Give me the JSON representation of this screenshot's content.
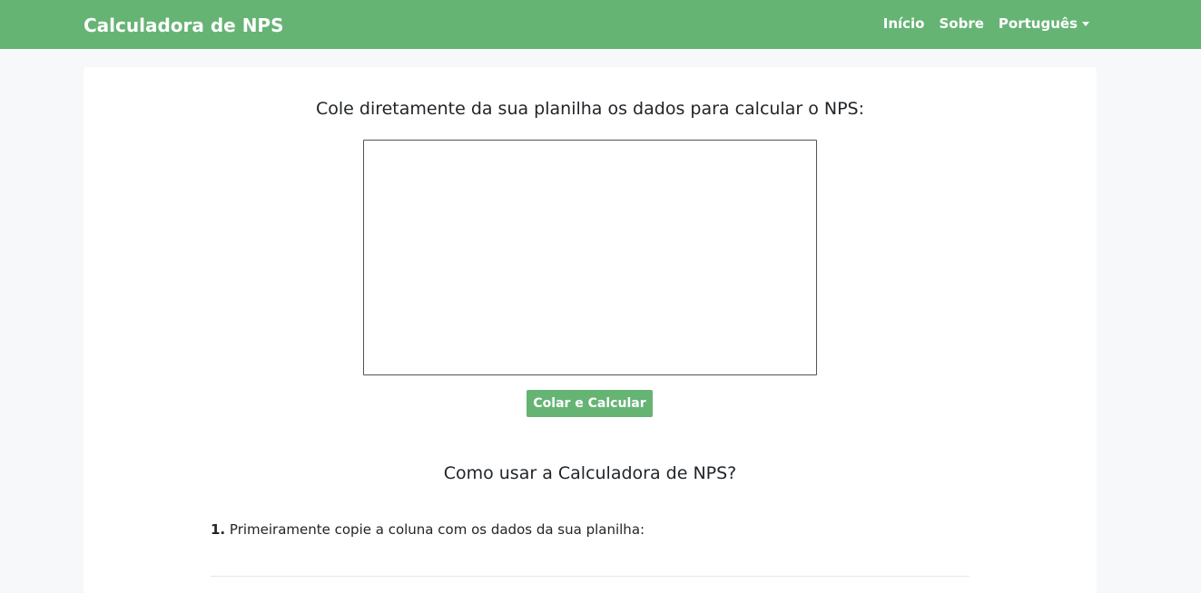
{
  "navbar": {
    "brand": "Calculadora de NPS",
    "links": [
      "Início",
      "Sobre"
    ],
    "language": "Português"
  },
  "main": {
    "prompt": "Cole diretamente da sua planilha os dados para calcular o NPS:",
    "textarea_value": "",
    "button_label": "Colar e Calcular",
    "howto_title": "Como usar a Calculadora de NPS?",
    "steps": [
      {
        "number": "1.",
        "text": "Primeiramente copie a coluna com os dados da sua planilha:"
      }
    ]
  },
  "colors": {
    "accent": "#66b474",
    "page_background": "#f6f8fa",
    "card_background": "#ffffff"
  }
}
